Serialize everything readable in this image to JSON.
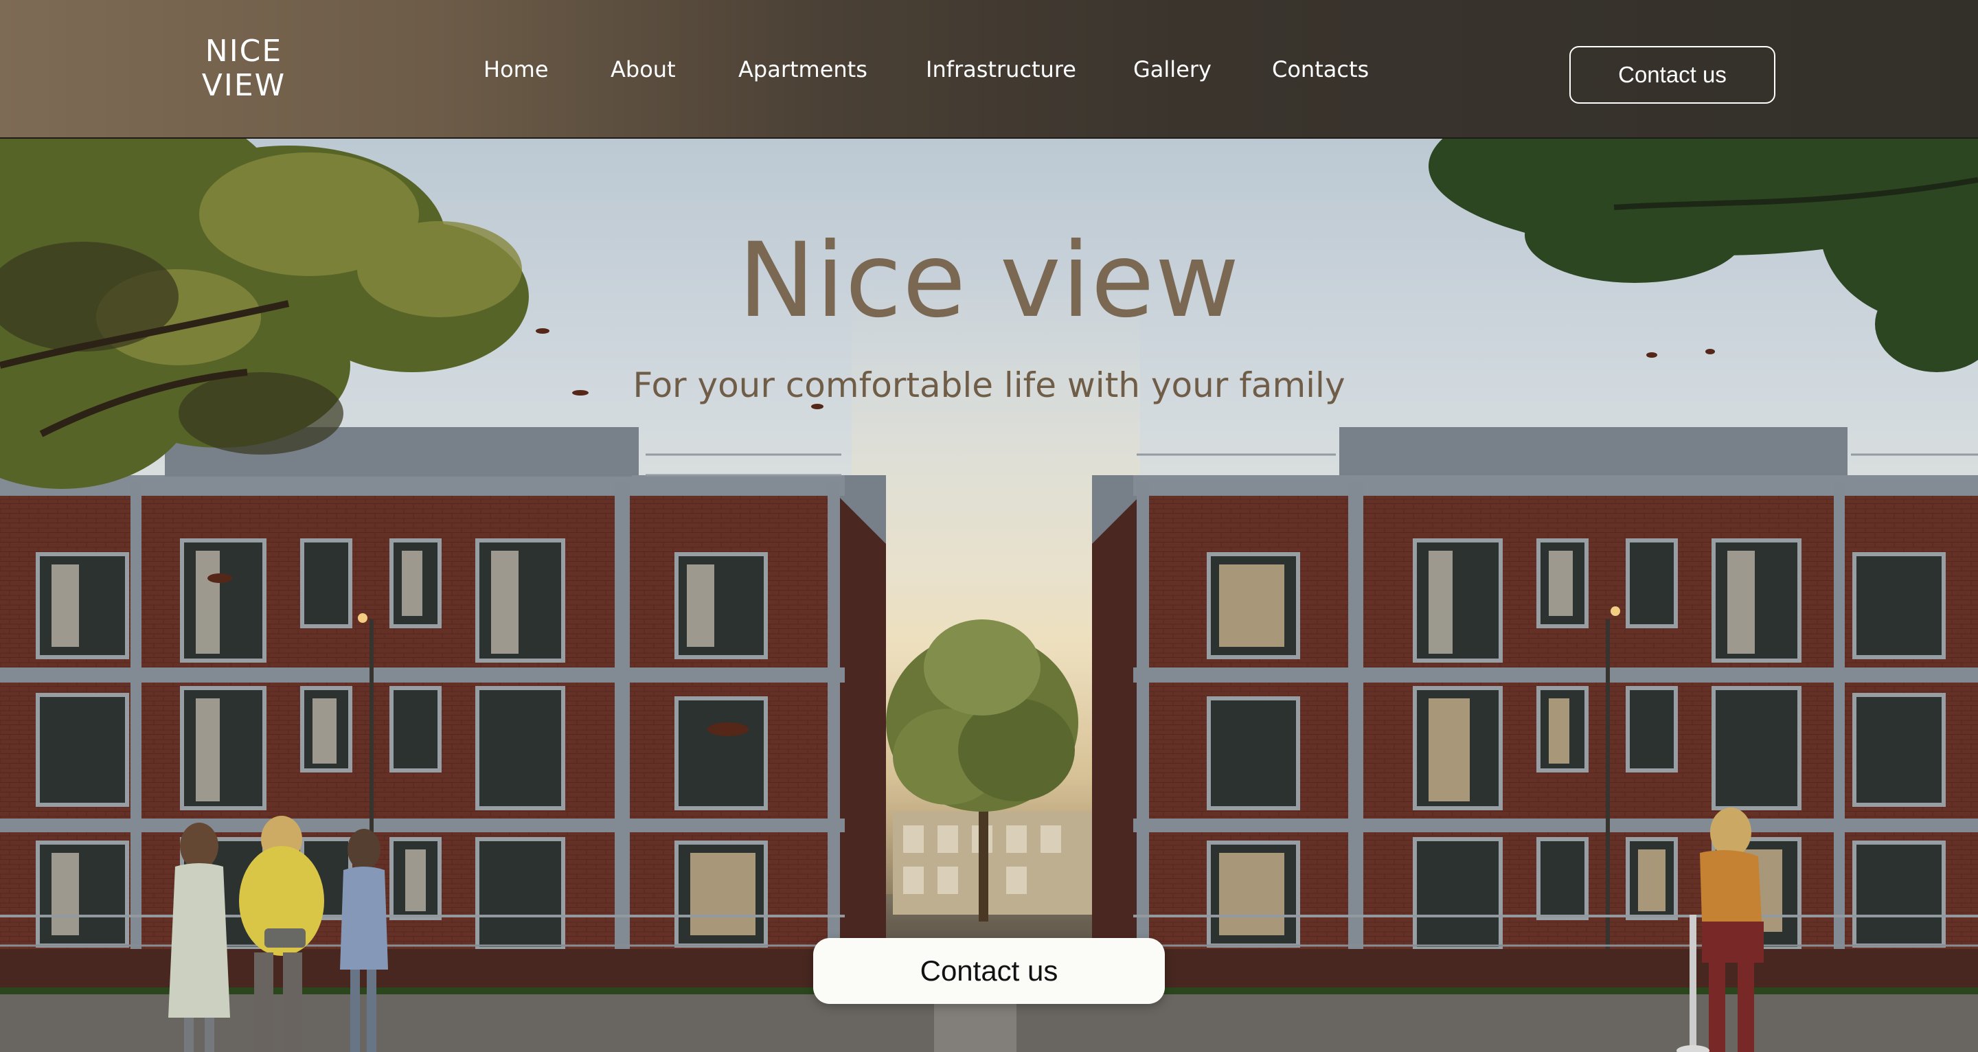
{
  "brand": {
    "logo_line1": "NICE",
    "logo_line2": "VIEW"
  },
  "nav": {
    "items": [
      {
        "label": "Home"
      },
      {
        "label": "About"
      },
      {
        "label": "Apartments"
      },
      {
        "label": "Infrastructure"
      },
      {
        "label": "Gallery"
      },
      {
        "label": "Contacts"
      }
    ]
  },
  "header": {
    "cta_label": "Contact us"
  },
  "hero": {
    "title": "Nice view",
    "subtitle": "For your comfortable life with your family",
    "cta_label": "Contact us",
    "image_icon": "apartment-buildings-photo"
  },
  "colors": {
    "header_left": "#7e6b55",
    "header_right": "#33302a",
    "title": "#7a6852",
    "subtitle": "#6f5d47",
    "brick": "#6a3328",
    "cta_background": "#fbfbf8"
  }
}
